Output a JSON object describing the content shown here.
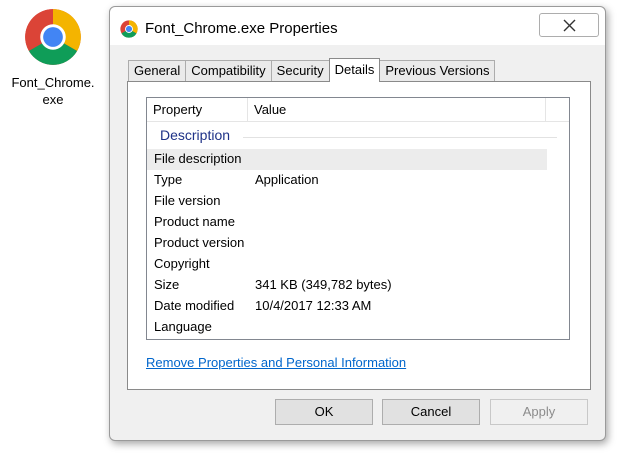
{
  "desktop_icon": {
    "label": "Font_Chrome.\nexe",
    "icon": "chrome-icon"
  },
  "dialog": {
    "title": "Font_Chrome.exe Properties",
    "title_icon": "chrome-icon",
    "tabs": [
      {
        "label": "General",
        "active": false
      },
      {
        "label": "Compatibility",
        "active": false
      },
      {
        "label": "Security",
        "active": false
      },
      {
        "label": "Details",
        "active": true
      },
      {
        "label": "Previous Versions",
        "active": false
      }
    ],
    "details": {
      "columns": [
        "Property",
        "Value"
      ],
      "group": "Description",
      "rows": [
        {
          "property": "File description",
          "value": ""
        },
        {
          "property": "Type",
          "value": "Application"
        },
        {
          "property": "File version",
          "value": ""
        },
        {
          "property": "Product name",
          "value": ""
        },
        {
          "property": "Product version",
          "value": ""
        },
        {
          "property": "Copyright",
          "value": ""
        },
        {
          "property": "Size",
          "value": "341 KB (349,782 bytes)"
        },
        {
          "property": "Date modified",
          "value": "10/4/2017 12:33 AM"
        },
        {
          "property": "Language",
          "value": ""
        }
      ],
      "remove_link": "Remove Properties and Personal Information"
    },
    "buttons": {
      "ok": "OK",
      "cancel": "Cancel",
      "apply": "Apply"
    }
  }
}
